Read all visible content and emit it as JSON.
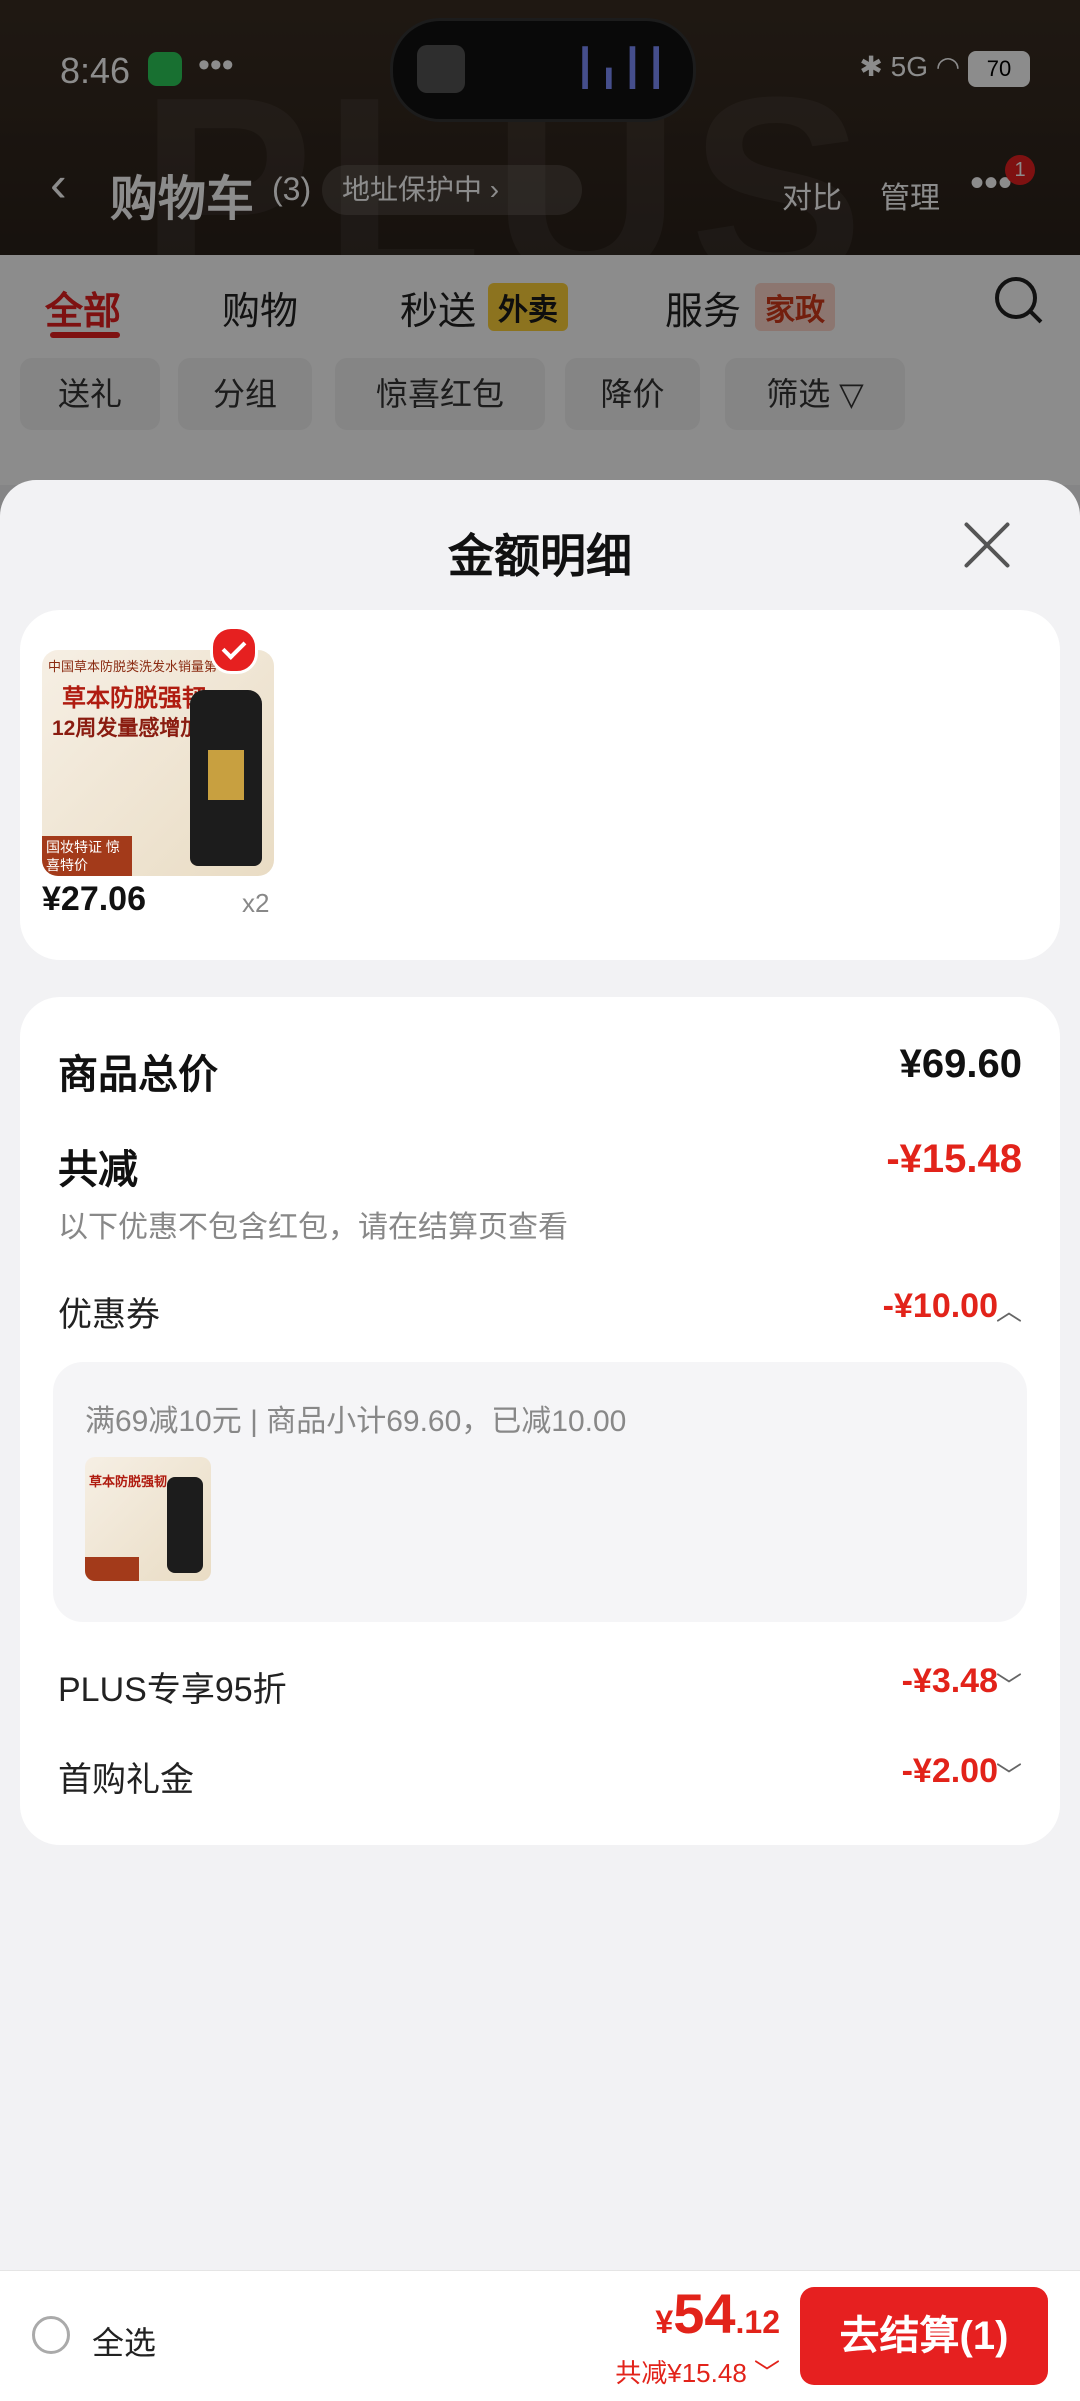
{
  "status_bar": {
    "time": "8:46",
    "battery": "70",
    "network": "5G"
  },
  "header": {
    "back_glyph": "‹",
    "title": "购物车",
    "count": "(3)",
    "address_pill": "地址保护中 ›",
    "compare": "对比",
    "manage": "管理",
    "more_glyph": "•••",
    "notif_badge": "1"
  },
  "watermark": "PLUS",
  "tabs": [
    {
      "label": "全部"
    },
    {
      "label": "购物"
    },
    {
      "label": "秒送",
      "tag": "外卖"
    },
    {
      "label": "服务",
      "tag": "家政"
    }
  ],
  "filters": [
    "送礼",
    "分组",
    "惊喜红包",
    "降价",
    "筛选 ▽"
  ],
  "sheet": {
    "title": "金额明细",
    "product": {
      "image_text_top": "中国草本防脱类洗发水销量第一",
      "image_text_main": "草本防脱强韧",
      "image_text_sub": "12周发量感增加",
      "image_ribbon": "国妆特证 惊喜特价",
      "price": "¥27.06",
      "qty": "x2"
    },
    "summary": {
      "total_label": "商品总价",
      "total_value": "¥69.60",
      "discount_label": "共减",
      "discount_value": "-¥15.48",
      "note": "以下优惠不包含红包，请在结算页查看",
      "coupon_label": "优惠券",
      "coupon_value": "-¥10.00",
      "coupon_chevron": "︿",
      "coupon_detail": "满69减10元 | 商品小计69.60，已减10.00",
      "plus_label": "PLUS专享95折",
      "plus_value": "-¥3.48",
      "gift_label": "首购礼金",
      "gift_value": "-¥2.00",
      "down_chevron": "﹀"
    }
  },
  "bottom_bar": {
    "select_all": "全选",
    "currency": "¥",
    "total_int": "54",
    "total_dec": ".12",
    "saved": "共减¥15.48 ﹀",
    "checkout": "去结算(1)"
  },
  "colors": {
    "accent": "#e2231a",
    "header_bg": "#3a2d22",
    "sheet_bg": "#f2f2f4"
  }
}
